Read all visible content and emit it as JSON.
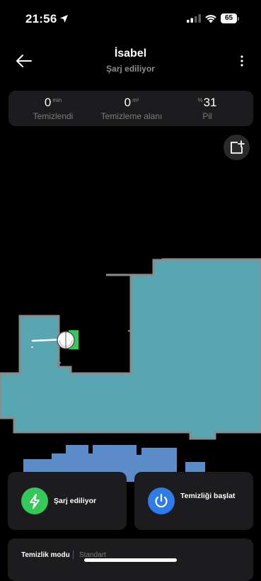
{
  "status_bar": {
    "time": "21:56",
    "battery_level": "65",
    "icons": [
      "location-arrow-icon",
      "cellular-signal-icon",
      "wifi-icon",
      "battery-icon"
    ]
  },
  "header": {
    "title": "İsabel",
    "subtitle": "Şarj ediliyor",
    "back_icon": "arrow-left-icon",
    "more_icon": "more-vertical-icon"
  },
  "stats": {
    "cleaned_time": {
      "value": "0",
      "unit": "min",
      "label": "Temizlendi"
    },
    "cleaned_area": {
      "value": "0",
      "unit": "m²",
      "label": "Temizleme alanı"
    },
    "battery": {
      "prefix": "%",
      "value": "31",
      "label": "Pil"
    }
  },
  "map": {
    "add_area_icon": "map-add-icon",
    "colors": {
      "room_primary": "#57a6b2",
      "room_secondary": "#5b8cc9",
      "wall": "#8b8b8b",
      "dock": "#34c759"
    }
  },
  "actions": {
    "charge": {
      "label": "Şarj ediliyor",
      "icon": "lightning-icon",
      "color": "#34c759"
    },
    "start": {
      "label": "Temizliği başlat",
      "icon": "power-icon",
      "color": "#2f7be9"
    }
  },
  "cleaning_mode": {
    "label": "Temizlik modu",
    "value": "Standart"
  }
}
